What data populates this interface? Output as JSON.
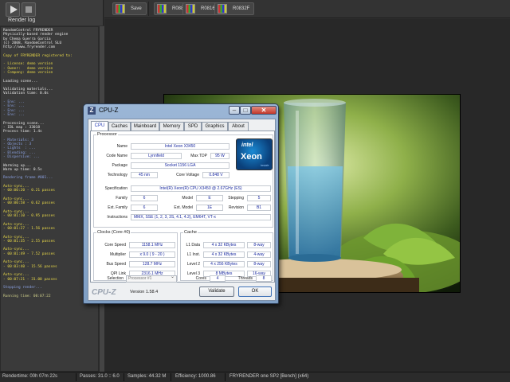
{
  "toolbar": {
    "items": [
      {
        "label": "Save"
      },
      {
        "label": "R088"
      },
      {
        "label": "R0816"
      },
      {
        "label": "R0832F"
      }
    ]
  },
  "log": {
    "title": "Render log",
    "lines": [
      {
        "t": "RandomControl FRYRENDER",
        "c": "w"
      },
      {
        "t": "Physically-based render engine",
        "c": "w"
      },
      {
        "t": "by Chema Guerra Garcia",
        "c": "w"
      },
      {
        "t": "(c) 2008, RandomControl SLU",
        "c": "w"
      },
      {
        "t": "http://www.fryrender.com",
        "c": "w"
      },
      {
        "t": "",
        "c": "w"
      },
      {
        "t": "Copy of FRYRENDER registered to:",
        "c": "y"
      },
      {
        "t": "",
        "c": "w"
      },
      {
        "t": "- License: demo version",
        "c": "y"
      },
      {
        "t": "- Owner:   demo version",
        "c": "y"
      },
      {
        "t": "- Company: demo version",
        "c": "y"
      },
      {
        "t": "",
        "c": "w"
      },
      {
        "t": "Loading scene...",
        "c": "w"
      },
      {
        "t": "",
        "c": "w"
      },
      {
        "t": "Validating materials...",
        "c": "w"
      },
      {
        "t": "Validation time: 0.0s",
        "c": "w"
      },
      {
        "t": "",
        "c": "w"
      },
      {
        "t": "- Env: ...",
        "c": "b"
      },
      {
        "t": "- Env: ...",
        "c": "b"
      },
      {
        "t": "- Env: ...",
        "c": "b"
      },
      {
        "t": "- Env: ...",
        "c": "b"
      },
      {
        "t": "",
        "c": "w"
      },
      {
        "t": "Processing scene...",
        "c": "w"
      },
      {
        "t": "- IBL map : 33018",
        "c": "w"
      },
      {
        "t": "Process time: 1.4s",
        "c": "w"
      },
      {
        "t": "",
        "c": "w"
      },
      {
        "t": "- Materials: 3",
        "c": "b"
      },
      {
        "t": "- Objects : 3",
        "c": "b"
      },
      {
        "t": "- Lights  : ...",
        "c": "b"
      },
      {
        "t": "- Blending: ...",
        "c": "b"
      },
      {
        "t": "- Dispersive: ...",
        "c": "b"
      },
      {
        "t": "",
        "c": "w"
      },
      {
        "t": "Warming up...",
        "c": "w"
      },
      {
        "t": "Warm up time: 0.5s",
        "c": "w"
      },
      {
        "t": "",
        "c": "w"
      },
      {
        "t": "Rendering frame #001...",
        "c": "b"
      },
      {
        "t": "",
        "c": "w"
      },
      {
        "t": "Auto-sync...",
        "c": "y"
      },
      {
        "t": "- 00:00:20 - 0.21 passes",
        "c": "y"
      },
      {
        "t": "",
        "c": "w"
      },
      {
        "t": "Auto-sync...",
        "c": "y"
      },
      {
        "t": "- 00:00:58 - 0.62 passes",
        "c": "y"
      },
      {
        "t": "",
        "c": "w"
      },
      {
        "t": "Auto-sync...",
        "c": "y"
      },
      {
        "t": "- 00:01:10 - 0.95 passes",
        "c": "y"
      },
      {
        "t": "",
        "c": "w"
      },
      {
        "t": "Auto-sync...",
        "c": "y"
      },
      {
        "t": "- 00:01:27 - 1.56 passes",
        "c": "y"
      },
      {
        "t": "",
        "c": "w"
      },
      {
        "t": "Auto-sync...",
        "c": "y"
      },
      {
        "t": "- 00:01:35 - 2.55 passes",
        "c": "y"
      },
      {
        "t": "",
        "c": "w"
      },
      {
        "t": "Auto-sync...",
        "c": "y"
      },
      {
        "t": "- 00:01:49 - 7.52 passes",
        "c": "y"
      },
      {
        "t": "",
        "c": "w"
      },
      {
        "t": "Auto-sync...",
        "c": "y"
      },
      {
        "t": "- 00:03:40 - 15.56 passes",
        "c": "y"
      },
      {
        "t": "",
        "c": "w"
      },
      {
        "t": "Auto-sync...",
        "c": "y"
      },
      {
        "t": "- 00:07:21 - 31.00 passes",
        "c": "y"
      },
      {
        "t": "",
        "c": "w"
      },
      {
        "t": "Stopping render...",
        "c": "b"
      },
      {
        "t": "",
        "c": "w"
      },
      {
        "t": "Running time: 00:07:22",
        "c": "g"
      }
    ]
  },
  "status": {
    "rendertime": "Rendertime:  00h 07m 22s",
    "passes": "Passes:  31.0 :: 6.0",
    "samples": "Samples:  44.32 M",
    "efficiency": "Efficiency:  1000.86",
    "engine": "FRYRENDER one SP2 [Bench] (x64)"
  },
  "cpuz": {
    "title": "CPU-Z",
    "tabs": [
      "CPU",
      "Caches",
      "Mainboard",
      "Memory",
      "SPD",
      "Graphics",
      "About"
    ],
    "processor": {
      "legend": "Processor",
      "name_label": "Name",
      "name": "Intel Xeon X3450",
      "codename_label": "Code Name",
      "codename": "Lynnfield",
      "maxtdp_label": "Max TDP",
      "maxtdp": "95 W",
      "package_label": "Package",
      "package": "Socket 1156 LGA",
      "technology_label": "Technology",
      "technology": "45 nm",
      "corevoltage_label": "Core Voltage",
      "corevoltage": "0.848 V",
      "spec_label": "Specification",
      "spec": "Intel(R) Xeon(R) CPU         X3450  @ 2.67GHz (ES)",
      "family_label": "Family",
      "family": "6",
      "model_label": "Model",
      "model": "E",
      "stepping_label": "Stepping",
      "stepping": "5",
      "extfamily_label": "Ext. Family",
      "extfamily": "6",
      "extmodel_label": "Ext. Model",
      "extmodel": "1E",
      "revision_label": "Revision",
      "revision": "B1",
      "instr_label": "Instructions",
      "instr": "MMX, SSE (1, 2, 3, 3S, 4.1, 4.2), EM64T, VT-x",
      "logo_text": "intel",
      "logo_product": "Xeon",
      "logo_sub": "inside"
    },
    "clocks": {
      "legend": "Clocks (Core #0)",
      "corespeed_label": "Core Speed",
      "corespeed": "1158.1 MHz",
      "multiplier_label": "Multiplier",
      "multiplier": "x 9.0 ( 9 - 20 )",
      "busspeed_label": "Bus Speed",
      "busspeed": "128.7 MHz",
      "qpi_label": "QPI Link",
      "qpi": "2316.1 MHz"
    },
    "cache": {
      "legend": "Cache",
      "l1d_label": "L1 Data",
      "l1d": "4 x 32 KBytes",
      "l1d_way": "8-way",
      "l1i_label": "L1 Inst.",
      "l1i": "4 x 32 KBytes",
      "l1i_way": "4-way",
      "l2_label": "Level 2",
      "l2": "4 x 256 KBytes",
      "l2_way": "8-way",
      "l3_label": "Level 3",
      "l3": "8 MBytes",
      "l3_way": "16-way"
    },
    "selection_label": "Selection",
    "selection": "Processor #1",
    "cores_label": "Cores",
    "cores": "4",
    "threads_label": "Threads",
    "threads": "8",
    "brand": "CPU-Z",
    "version": "Version 1.58.4",
    "validate": "Validate",
    "ok": "OK"
  }
}
